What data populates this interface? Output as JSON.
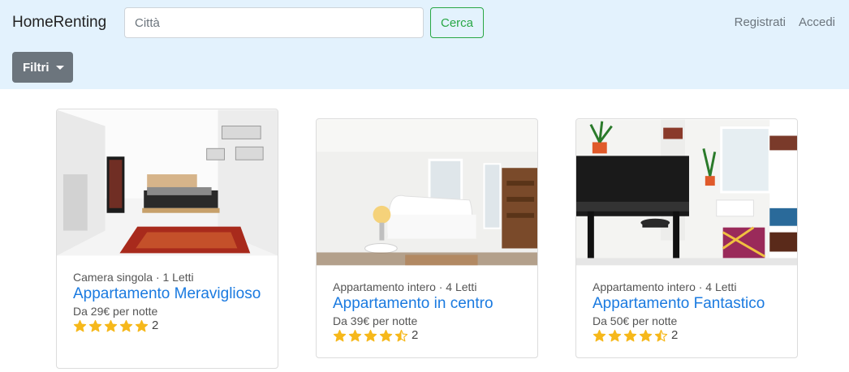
{
  "navbar": {
    "brand": "HomeRenting",
    "search_placeholder": "Città",
    "search_button": "Cerca",
    "links": [
      "Registrati",
      "Accedi"
    ],
    "filter_button": "Filtri"
  },
  "colors": {
    "navbar_bg": "#e3f2fd",
    "title_link": "#1a7ae0",
    "star": "#f6b81b",
    "search_button": "#28a745",
    "filter_button": "#6c757d"
  },
  "listings": [
    {
      "subtitle": "Camera singola · 1 Letti",
      "title": "Appartamento Meraviglioso",
      "price": "Da 29€ per notte",
      "rating": 5,
      "reviews": "2",
      "image": "bedroom-photo"
    },
    {
      "subtitle": "Appartamento intero · 4 Letti",
      "title": "Appartamento in centro",
      "price": "Da 39€ per notte",
      "rating": 4.5,
      "reviews": "2",
      "image": "bedroom-photo"
    },
    {
      "subtitle": "Appartamento intero · 4 Letti",
      "title": "Appartamento Fantastico",
      "price": "Da 50€ per notte",
      "rating": 4.5,
      "reviews": "2",
      "image": "piano-room-photo"
    }
  ]
}
